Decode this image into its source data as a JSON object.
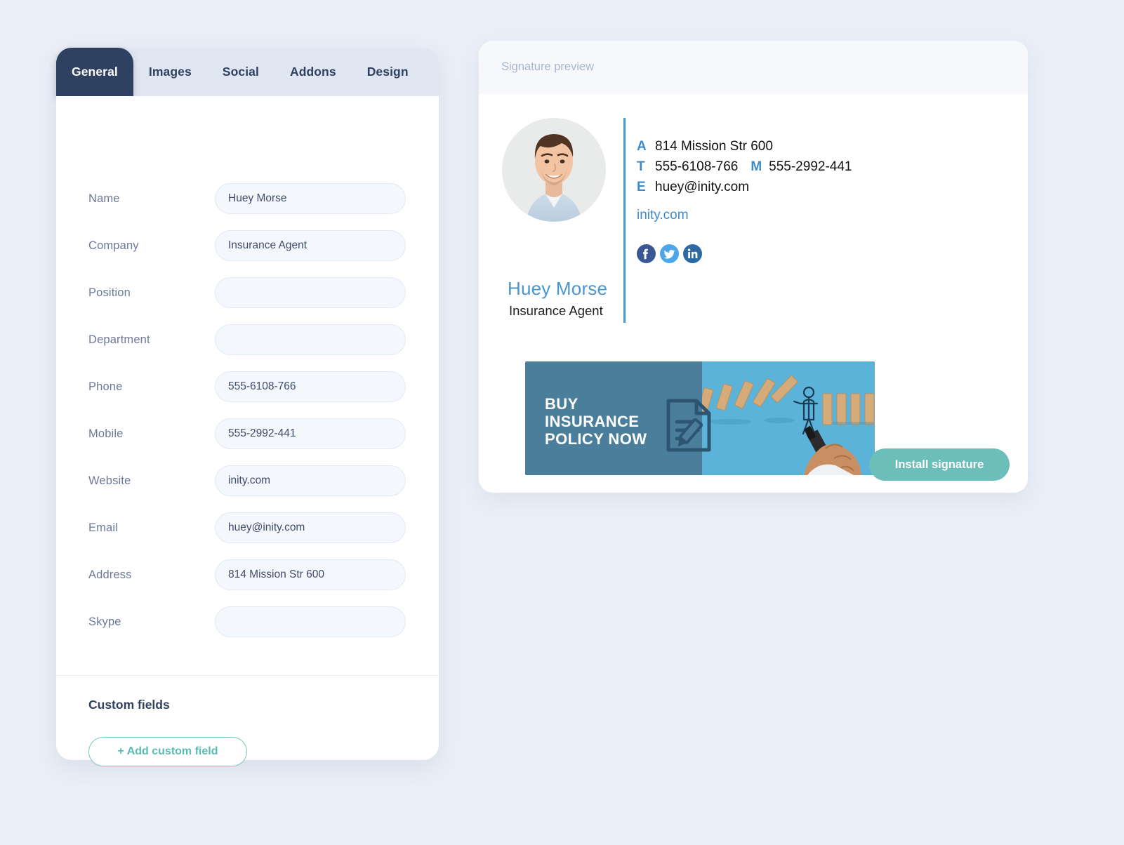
{
  "editor": {
    "tabs": [
      {
        "label": "General",
        "active": true
      },
      {
        "label": "Images",
        "active": false
      },
      {
        "label": "Social",
        "active": false
      },
      {
        "label": "Addons",
        "active": false
      },
      {
        "label": "Design",
        "active": false
      }
    ],
    "fields": [
      {
        "label": "Name",
        "value": "Huey Morse",
        "placeholder": ""
      },
      {
        "label": "Company",
        "value": "Insurance Agent",
        "placeholder": ""
      },
      {
        "label": "Position",
        "value": "",
        "placeholder": ""
      },
      {
        "label": "Department",
        "value": "",
        "placeholder": ""
      },
      {
        "label": "Phone",
        "value": "555-6108-766",
        "placeholder": ""
      },
      {
        "label": "Mobile",
        "value": "555-2992-441",
        "placeholder": ""
      },
      {
        "label": "Website",
        "value": "inity.com",
        "placeholder": ""
      },
      {
        "label": "Email",
        "value": "huey@inity.com",
        "placeholder": ""
      },
      {
        "label": "Address",
        "value": "814 Mission Str 600",
        "placeholder": ""
      },
      {
        "label": "Skype",
        "value": "",
        "placeholder": ""
      }
    ],
    "custom_fields_title": "Custom fields",
    "add_custom_field_label": "+ Add custom field"
  },
  "preview": {
    "header_label": "Signature preview",
    "signature": {
      "avatar_alt": "portrait-photo",
      "name": "Huey Morse",
      "role": "Insurance Agent",
      "details": [
        {
          "key": "A",
          "value": "814 Mission Str 600"
        },
        {
          "key": "T",
          "value": "555-6108-766",
          "key2": "M",
          "value2": "555-2992-441"
        },
        {
          "key": "E",
          "value": "huey@inity.com"
        }
      ],
      "website": "inity.com",
      "socials": [
        {
          "name": "facebook",
          "color": "#3a5795"
        },
        {
          "name": "twitter",
          "color": "#4ea6e8"
        },
        {
          "name": "linkedin",
          "color": "#2d6aa3"
        }
      ]
    },
    "banner": {
      "line1": "BUY",
      "line2": "INSURANCE",
      "line3": "POLICY NOW",
      "left_color": "#4b7e9b",
      "right_color": "#5cb3d9"
    },
    "install_button_label": "Install signature"
  },
  "colors": {
    "page_background": "#eaeef7",
    "tab_active": "#2e4161",
    "tab_inactive_bar": "#e1e7f2",
    "accent_teal": "#6bbfb8",
    "link_blue": "#3d8cc9"
  }
}
